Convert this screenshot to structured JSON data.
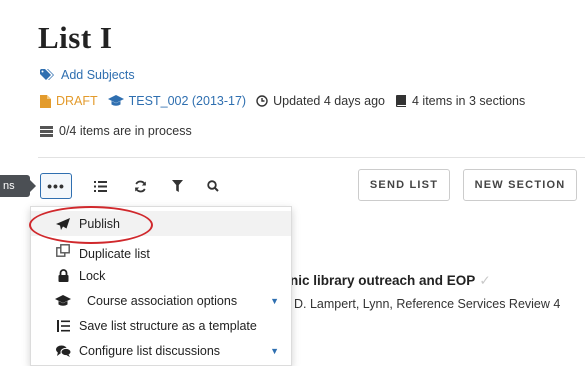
{
  "header": {
    "title": "List I",
    "add_subjects": "Add Subjects"
  },
  "meta": {
    "status": "DRAFT",
    "course": "TEST_002 (2013-17)",
    "updated": "Updated 4 days ago",
    "items": "4 items in 3 sections"
  },
  "process": "0/4 items are in process",
  "side_tab": "ns",
  "toolbar": {
    "more_label": "•••",
    "send_list": "SEND LIST",
    "new_section": "NEW SECTION"
  },
  "item": {
    "title": "nic library outreach and EOP",
    "citation": "D. Lampert, Lynn, Reference Services Review 4"
  },
  "menu": {
    "publish": "Publish",
    "duplicate": "Duplicate list",
    "lock": "Lock",
    "course": "Course association options",
    "template": "Save list structure as a template",
    "discussions": "Configure list discussions"
  },
  "colors": {
    "link": "#2f6fb0",
    "draft": "#e39b2c",
    "highlight": "#d0282c"
  }
}
